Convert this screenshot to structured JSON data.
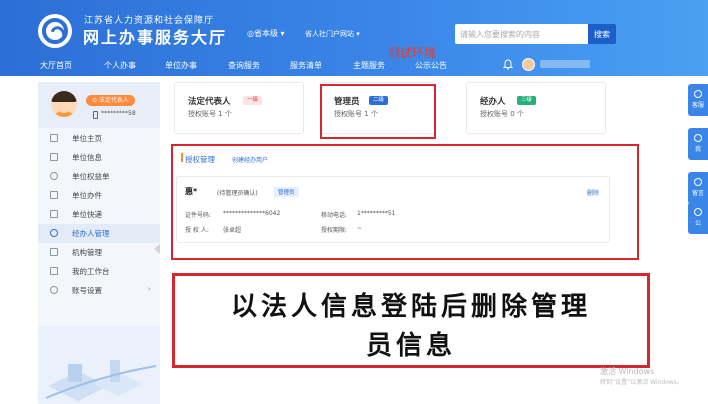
{
  "header": {
    "subtitle": "江苏省人力资源和社会保障厅",
    "title": "网上办事服务大厅",
    "level_select": "◎省本级 ▾",
    "portal_link": "省人社门户网站 ▾",
    "search_placeholder": "请输入您要搜索的内容",
    "search_button": "搜索",
    "test_env_label": "测试环境"
  },
  "nav": {
    "items": [
      "大厅首页",
      "个人办事",
      "单位办事",
      "查询服务",
      "服务清单",
      "主题服务",
      "公示公告"
    ]
  },
  "sidebar": {
    "role_badge": "⊙ 法定代表人",
    "phone": "*********58",
    "items": [
      {
        "label": "单位主页",
        "icon": "home-icon",
        "active": false
      },
      {
        "label": "单位信息",
        "icon": "info-icon",
        "active": false
      },
      {
        "label": "单位权益单",
        "icon": "rights-icon",
        "active": false
      },
      {
        "label": "单位办件",
        "icon": "file-icon",
        "active": false
      },
      {
        "label": "单位快递",
        "icon": "folder-icon",
        "active": false
      },
      {
        "label": "经办人管理",
        "icon": "user-icon",
        "active": true
      },
      {
        "label": "机构管理",
        "icon": "org-icon",
        "active": false
      },
      {
        "label": "我的工作台",
        "icon": "desk-icon",
        "active": false
      },
      {
        "label": "账号设置",
        "icon": "settings-icon",
        "active": false,
        "has_arrow": true
      }
    ]
  },
  "roles": [
    {
      "title": "法定代表人",
      "tag": "一级",
      "meta": "授权账号  1 个",
      "tag_bg": "#fde2e2",
      "tag_color": "#e04040"
    },
    {
      "title": "管理员",
      "tag": "二级",
      "meta": "授权账号  1 个",
      "tag_bg": "#2c6fd6",
      "tag_color": "#ffffff"
    },
    {
      "title": "经办人",
      "tag": "三级",
      "meta": "授权账号  0 个",
      "tag_bg": "#27b07a",
      "tag_color": "#ffffff"
    }
  ],
  "auth_panel": {
    "title": "授权管理",
    "create_link": "创建经办用户",
    "record": {
      "name": "惠*",
      "status": "(待管理员确认)",
      "role_tag": "管理员",
      "delete_label": "删除",
      "id_label": "证件号码:",
      "id_value": "**************6042",
      "phone_label": "移动电话:",
      "phone_value": "1*********51",
      "grantor_label": "授 权 人:",
      "grantor_value": "张卓超",
      "period_label": "授权期限:",
      "period_value": "~"
    }
  },
  "annotation": {
    "line1": "以法人信息登陆后删除管理",
    "line2": "员信息"
  },
  "side_tools": [
    "客服",
    "我",
    "留言",
    "公"
  ],
  "watermark": {
    "line1": "激活 Windows",
    "line2": "转到“设置”以激活 Windows。"
  },
  "colors": {
    "header_blue": "#2c6fd6",
    "annotation_red": "#d8262e",
    "active_blue": "#2c6fd6"
  }
}
